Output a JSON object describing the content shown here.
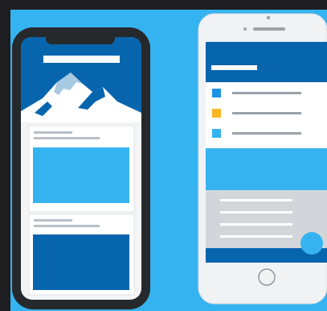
{
  "colors": {
    "background": "#35b3f0",
    "dark_blue": "#0765ad",
    "light_blue": "#35b3f0",
    "phone_black": "#26292b",
    "phone_white": "#f1f2f4",
    "gray_panel": "#d2d6da",
    "bullet_blue": "#1c95e4",
    "bullet_yellow": "#fbb624",
    "bullet_cyan": "#35b3f0"
  },
  "icons": [
    "mountain-icon",
    "home-button-icon"
  ]
}
